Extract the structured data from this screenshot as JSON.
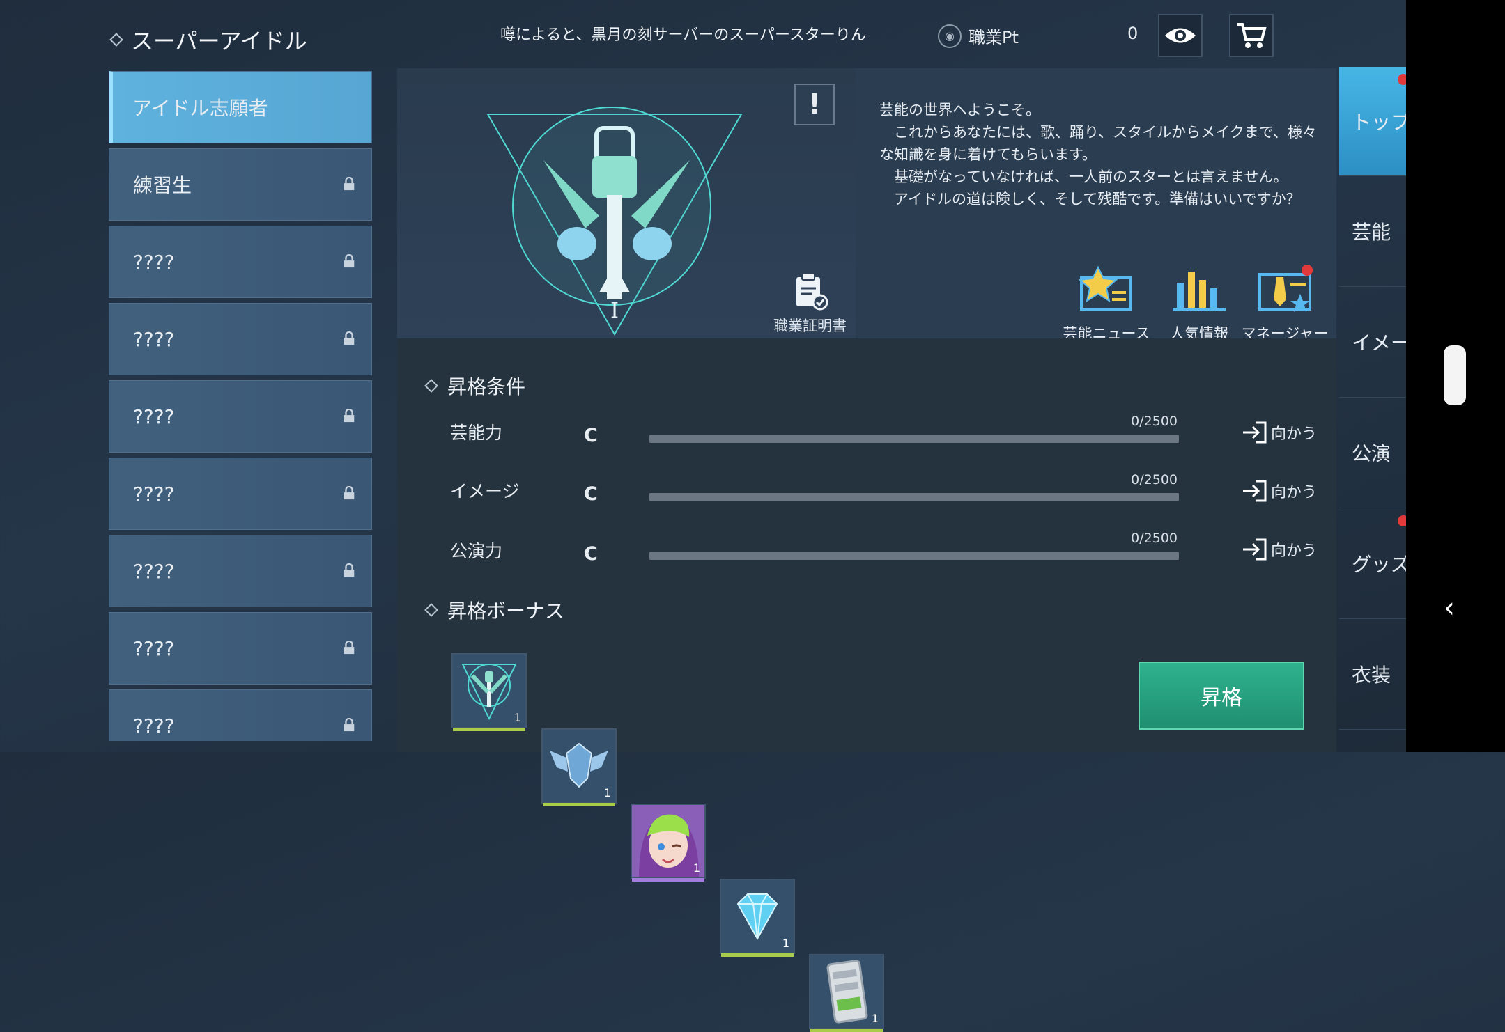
{
  "header": {
    "title": "スーパーアイドル",
    "ticker": "噂によると、黒月の刻サーバーのスーパースターりん",
    "points_label": "職業Pt",
    "points_value": "0"
  },
  "sidebar": {
    "items": [
      {
        "label": "アイドル志願者",
        "locked": false
      },
      {
        "label": "練習生",
        "locked": true
      },
      {
        "label": "????",
        "locked": true
      },
      {
        "label": "????",
        "locked": true
      },
      {
        "label": "????",
        "locked": true
      },
      {
        "label": "????",
        "locked": true
      },
      {
        "label": "????",
        "locked": true
      },
      {
        "label": "????",
        "locked": true
      },
      {
        "label": "????",
        "locked": true
      }
    ]
  },
  "emblem": {
    "numeral": "I",
    "certificate_label": "職業証明書"
  },
  "description": "芸能の世界へようこそ。\n　これからあなたには、歌、踊り、スタイルからメイクまで、様々な知識を身に着けてもらいます。\n　基礎がなっていなければ、一人前のスターとは言えません。\n　アイドルの道は険しく、そして残酷です。準備はいいですか？",
  "features": [
    {
      "label": "芸能ニュース",
      "icon": "news-icon"
    },
    {
      "label": "人気情報",
      "icon": "popularity-chart-icon"
    },
    {
      "label": "マネージャー",
      "icon": "manager-icon"
    }
  ],
  "conditions": {
    "title": "昇格条件",
    "rows": [
      {
        "label": "芸能力",
        "grade": "C",
        "progress": "0/2500",
        "fraction": 0,
        "goto": "向かう"
      },
      {
        "label": "イメージ",
        "grade": "C",
        "progress": "0/2500",
        "fraction": 0,
        "goto": "向かう"
      },
      {
        "label": "公演力",
        "grade": "C",
        "progress": "0/2500",
        "fraction": 0,
        "goto": "向かう"
      }
    ]
  },
  "bonus": {
    "title": "昇格ボーナス",
    "items": [
      {
        "name": "emblem-item",
        "qty": "1"
      },
      {
        "name": "wing-crest-item",
        "qty": "1"
      },
      {
        "name": "idol-portrait-item",
        "qty": "1"
      },
      {
        "name": "diamond-item",
        "qty": "1"
      },
      {
        "name": "phone-item",
        "qty": "1"
      }
    ]
  },
  "promote_label": "昇格",
  "right_tabs": [
    {
      "label": "トップ"
    },
    {
      "label": "芸能"
    },
    {
      "label": "イメージ"
    },
    {
      "label": "公演"
    },
    {
      "label": "グッズ"
    },
    {
      "label": "衣装"
    }
  ],
  "colors": {
    "accent": "#57a6d3",
    "promote": "#1f8f70",
    "badge": "#e23a3a"
  }
}
